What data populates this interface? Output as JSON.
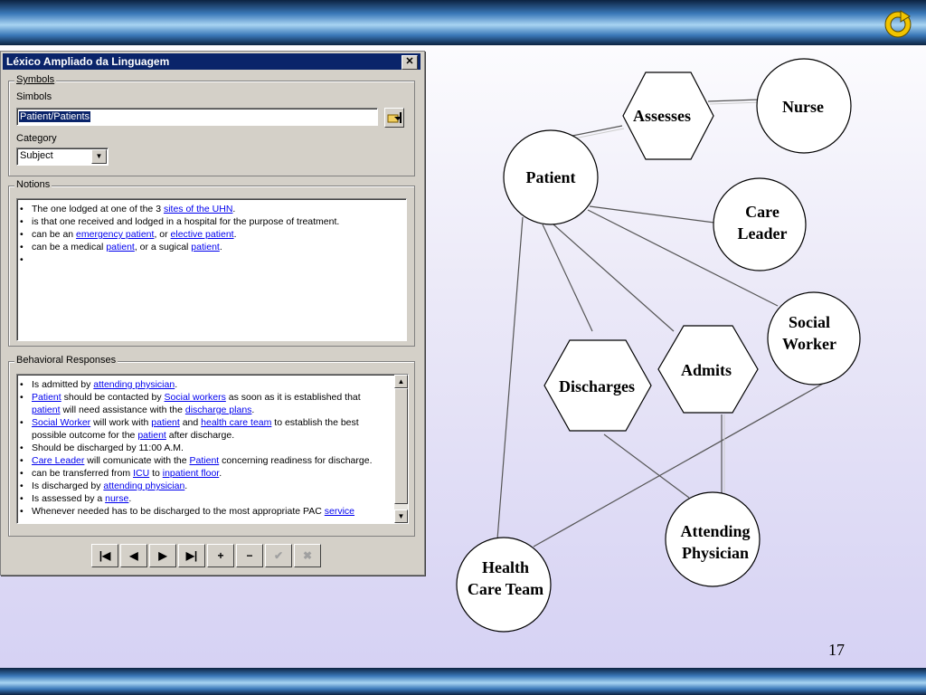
{
  "dialog": {
    "title": "Léxico Ampliado da Linguagem",
    "close": "✕",
    "symbols_group": "Symbols",
    "simbols_label": "Simbols",
    "symbol_value": "Patient/Patients",
    "category_label": "Category",
    "category_value": "Subject",
    "notions_group": "Notions",
    "behavioral_group": "Behavioral Responses"
  },
  "notions": [
    [
      {
        "t": "The one lodged at one of the 3 "
      },
      {
        "t": "sites of the UHN",
        "link": true
      },
      {
        "t": "."
      }
    ],
    [
      {
        "t": "is that one received and lodged in a hospital for the purpose of treatment."
      }
    ],
    [
      {
        "t": "can be an "
      },
      {
        "t": "emergency patient",
        "link": true
      },
      {
        "t": ", or "
      },
      {
        "t": "elective patient",
        "link": true
      },
      {
        "t": "."
      }
    ],
    [
      {
        "t": "can be a medical "
      },
      {
        "t": "patient",
        "link": true
      },
      {
        "t": ", or a sugical "
      },
      {
        "t": "patient",
        "link": true
      },
      {
        "t": "."
      }
    ],
    [
      {
        "t": ""
      }
    ]
  ],
  "behavioral": [
    [
      {
        "t": "Is admitted by "
      },
      {
        "t": "attending physician",
        "link": true
      },
      {
        "t": "."
      }
    ],
    [
      {
        "t": "Patient",
        "link": true
      },
      {
        "t": " should be contacted by "
      },
      {
        "t": "Social workers",
        "link": true
      },
      {
        "t": " as soon as it is established that "
      },
      {
        "t": "patient",
        "link": true
      },
      {
        "t": " will need assistance with the "
      },
      {
        "t": "discharge plans",
        "link": true
      },
      {
        "t": "."
      }
    ],
    [
      {
        "t": "Social Worker",
        "link": true
      },
      {
        "t": " will work with "
      },
      {
        "t": "patient",
        "link": true
      },
      {
        "t": " and "
      },
      {
        "t": "health care team",
        "link": true
      },
      {
        "t": " to establish the best possible outcome for the "
      },
      {
        "t": "patient",
        "link": true
      },
      {
        "t": " after discharge."
      }
    ],
    [
      {
        "t": "Should be discharged by 11:00 A.M."
      }
    ],
    [
      {
        "t": "Care Leader",
        "link": true
      },
      {
        "t": " will comunicate with the "
      },
      {
        "t": "Patient",
        "link": true
      },
      {
        "t": " concerning readiness for discharge."
      }
    ],
    [
      {
        "t": "can be transferred from "
      },
      {
        "t": "ICU",
        "link": true
      },
      {
        "t": " to "
      },
      {
        "t": "inpatient floor",
        "link": true
      },
      {
        "t": "."
      }
    ],
    [
      {
        "t": "Is discharged by "
      },
      {
        "t": "attending physician",
        "link": true
      },
      {
        "t": "."
      }
    ],
    [
      {
        "t": "Is assessed by a "
      },
      {
        "t": "nurse",
        "link": true
      },
      {
        "t": "."
      }
    ],
    [
      {
        "t": "Whenever needed has to be discharged to the most appropriate PAC "
      },
      {
        "t": "service",
        "link": true
      }
    ]
  ],
  "nav_buttons": [
    {
      "name": "first-record-button",
      "glyph": "|◀",
      "disabled": false
    },
    {
      "name": "prev-record-button",
      "glyph": "◀",
      "disabled": false
    },
    {
      "name": "next-record-button",
      "glyph": "▶",
      "disabled": false
    },
    {
      "name": "last-record-button",
      "glyph": "▶|",
      "disabled": false
    },
    {
      "name": "add-record-button",
      "glyph": "+",
      "disabled": false
    },
    {
      "name": "delete-record-button",
      "glyph": "−",
      "disabled": false
    },
    {
      "name": "confirm-button",
      "glyph": "✔",
      "disabled": true
    },
    {
      "name": "cancel-button",
      "glyph": "✖",
      "disabled": true
    }
  ],
  "diagram": {
    "nurse": "Nurse",
    "assesses": "Assesses",
    "patient": "Patient",
    "care_leader_1": "Care",
    "care_leader_2": "Leader",
    "social_worker_1": "Social",
    "social_worker_2": "Worker",
    "admits": "Admits",
    "discharges": "Discharges",
    "attending_1": "Attending",
    "attending_2": "Physician",
    "hct_1": "Health",
    "hct_2": "Care Team"
  },
  "page_number": "17",
  "colors": {
    "titlebar": "#0a246a",
    "link": "#0000ee",
    "nav_icon": "#f2c400"
  },
  "icons": {
    "nav": "return-arrow-icon",
    "browse": "folder-pointer-icon"
  }
}
